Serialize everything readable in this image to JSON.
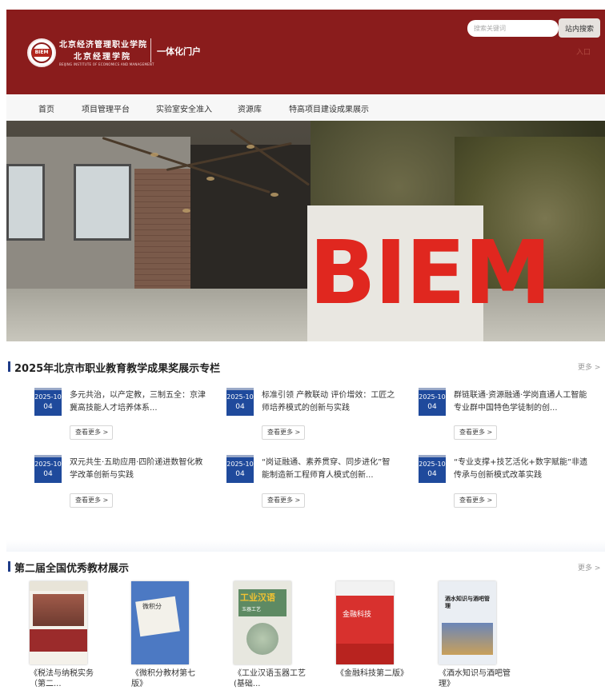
{
  "header": {
    "logo_emblem_text": "BIEM",
    "logo_line1": "北京经济管理职业学院",
    "logo_line2": "北京经理学院",
    "logo_en": "BEIJING INSTITUTE OF ECONOMICS AND MANAGEMENT",
    "portal_title": "一体化门户",
    "search_placeholder": "搜索关键词",
    "search_button": "站内搜索",
    "login": "入口",
    "brand_color": "#8a1c1c"
  },
  "nav": {
    "items": [
      "首页",
      "项目管理平台",
      "实验室安全准入",
      "资源库",
      "特高项目建设成果展示"
    ]
  },
  "banner": {
    "sign_text": "BIEM"
  },
  "section_news": {
    "title": "2025年北京市职业教育教学成果奖展示专栏",
    "more": "更多 >",
    "view_more_label": "查看更多 >",
    "items": [
      {
        "ym": "2025-10",
        "d": "04",
        "title": "多元共治，以产定教，三制五全：京津冀高技能人才培养体系..."
      },
      {
        "ym": "2025-10",
        "d": "04",
        "title": "标准引领 产教联动 评价增效：工匠之师培养模式的创新与实践"
      },
      {
        "ym": "2025-10",
        "d": "04",
        "title": "群链联通·资源融通·学岗直通人工智能专业群中国特色学徒制的创..."
      },
      {
        "ym": "2025-10",
        "d": "04",
        "title": "双元共生·五助应用·四阶递进数智化教学改革创新与实践"
      },
      {
        "ym": "2025-10",
        "d": "04",
        "title": "“岗证融通、素养贯穿、同步进化”智能制造新工程师育人模式创新..."
      },
      {
        "ym": "2025-10",
        "d": "04",
        "title": "“专业支撑+技艺活化+数字赋能”非遗传承与创新模式改革实践"
      }
    ]
  },
  "section_books": {
    "title": "第二届全国优秀教材展示",
    "more": "更多 >",
    "items": [
      {
        "title": "《税法与纳税实务（第二..."
      },
      {
        "title": "《微积分教材第七版》",
        "cover_text": "微积分"
      },
      {
        "title": "《工业汉语玉器工艺(基础...",
        "cover_text": "工业汉语",
        "cover_sub": "玉器工艺"
      },
      {
        "title": "《金融科技第二版》",
        "cover_text": "金融科技"
      },
      {
        "title": "《酒水知识与酒吧管理》",
        "cover_text": "酒水知识与酒吧管理"
      }
    ]
  }
}
